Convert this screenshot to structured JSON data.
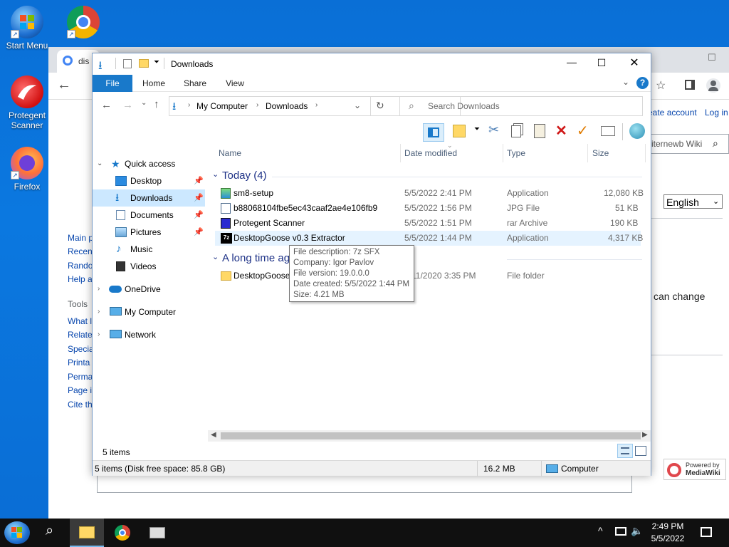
{
  "desktop": {
    "icons": [
      {
        "label": "Start Menu"
      },
      {
        "label": ""
      },
      {
        "label": "Protegent Scanner"
      },
      {
        "label": "Firefox"
      }
    ]
  },
  "browser": {
    "tab_title": "dis",
    "account_link": "eate account",
    "login_link": "Log in",
    "search_fragment": "iternewb Wiki",
    "language": "English",
    "fragment_text": "can change",
    "sidebar": [
      "Main p",
      "Recen",
      "Rando",
      "Help a"
    ],
    "tools_heading": "Tools",
    "tools": [
      "What l",
      "Relate",
      "Specia",
      "Printa",
      "Perma",
      "Page i",
      "Cite th"
    ],
    "powered_by_line1": "Powered by",
    "powered_by_line2": "MediaWiki"
  },
  "explorer": {
    "title": "Downloads",
    "tabs": {
      "file": "File",
      "home": "Home",
      "share": "Share",
      "view": "View"
    },
    "breadcrumb": [
      "My Computer",
      "Downloads"
    ],
    "search_placeholder": "Search Downloads",
    "nav": {
      "quick_access": "Quick access",
      "desktop": "Desktop",
      "downloads": "Downloads",
      "documents": "Documents",
      "pictures": "Pictures",
      "music": "Music",
      "videos": "Videos",
      "onedrive": "OneDrive",
      "my_computer": "My Computer",
      "network": "Network"
    },
    "columns": {
      "name": "Name",
      "date": "Date modified",
      "type": "Type",
      "size": "Size"
    },
    "groups": {
      "today": "Today (4)",
      "long_ago": "A long time ag"
    },
    "files": [
      {
        "name": "sm8-setup",
        "date": "5/5/2022 2:41 PM",
        "type": "Application",
        "size": "12,080 KB"
      },
      {
        "name": "b88068104fbe5ec43caaf2ae4e106fb9",
        "date": "5/5/2022 1:56 PM",
        "type": "JPG File",
        "size": "51 KB"
      },
      {
        "name": "Protegent Scanner",
        "date": "5/5/2022 1:51 PM",
        "type": "rar Archive",
        "size": "190 KB"
      },
      {
        "name": "DesktopGoose v0.3 Extractor",
        "date": "5/5/2022 1:44 PM",
        "type": "Application",
        "size": "4,317 KB"
      }
    ],
    "old_folder": {
      "name": "DesktopGoose",
      "date": "11/2020 3:35 PM",
      "type": "File folder"
    },
    "tooltip": {
      "line1": "File description: 7z SFX",
      "line2": "Company: Igor Pavlov",
      "line3": "File version: 19.0.0.0",
      "line4": "Date created: 5/5/2022 1:44 PM",
      "line5": "Size: 4.21 MB"
    },
    "item_count": "5 items",
    "status_left": "5 items (Disk free space: 85.8 GB)",
    "status_size": "16.2 MB",
    "status_location": "Computer"
  },
  "taskbar": {
    "time": "2:49 PM",
    "date": "5/5/2022"
  },
  "colors": {
    "desktop_bg": "#0a6fd6",
    "accent": "#1979ca",
    "selection": "#cce8ff",
    "taskbar": "#101010"
  }
}
